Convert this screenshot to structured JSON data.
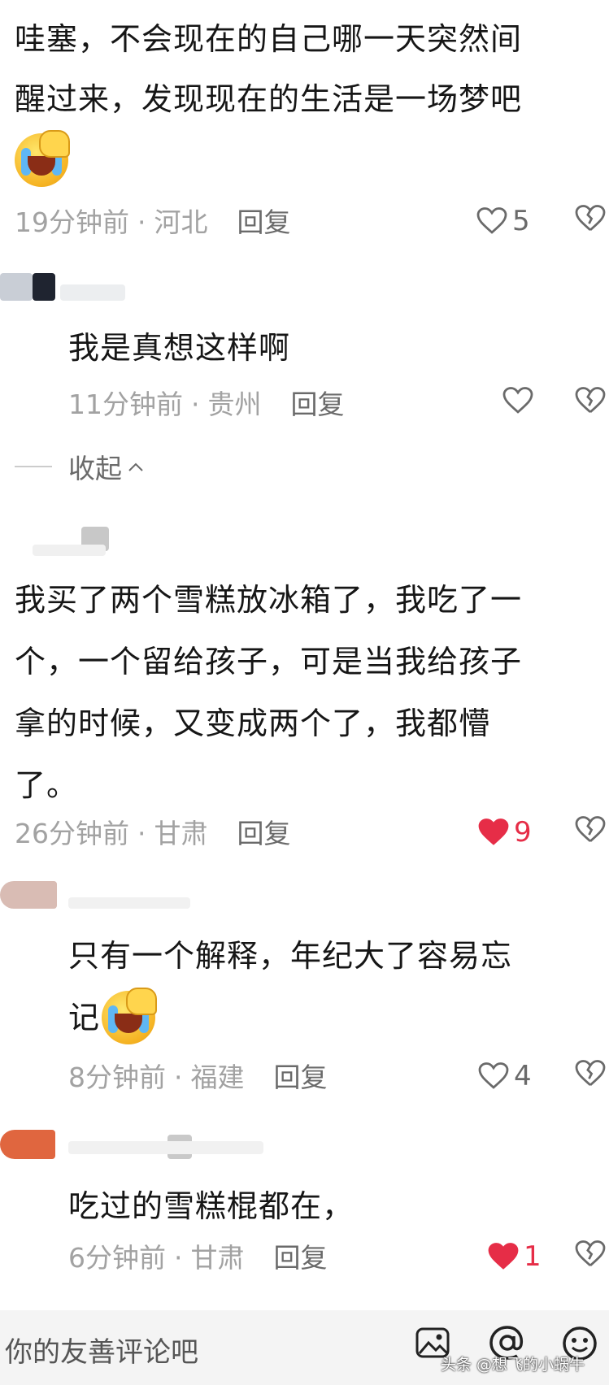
{
  "comments": [
    {
      "lines": [
        "哇塞，不会现在的自己哪一天突然间",
        "醒过来，发现现在的生活是一场梦吧"
      ],
      "emoji": "facepalm-laugh-cry",
      "time": "19分钟前",
      "location": "河北",
      "reply_label": "回复",
      "likes": "5",
      "liked": false
    },
    {
      "reply": true,
      "lines": [
        "我是真想这样啊"
      ],
      "time": "11分钟前",
      "location": "贵州",
      "reply_label": "回复",
      "likes": "",
      "liked": false
    },
    {
      "lines": [
        "我买了两个雪糕放冰箱了，我吃了一",
        "个，一个留给孩子，可是当我给孩子",
        "拿的时候，又变成两个了，我都懵",
        "了。"
      ],
      "time": "26分钟前",
      "location": "甘肃",
      "reply_label": "回复",
      "likes": "9",
      "liked": true
    },
    {
      "reply": true,
      "lines": [
        "只有一个解释，年纪大了容易忘",
        "记"
      ],
      "emoji": "facepalm-laugh-cry",
      "time": "8分钟前",
      "location": "福建",
      "reply_label": "回复",
      "likes": "4",
      "liked": false
    },
    {
      "reply": true,
      "lines": [
        "吃过的雪糕棍都在，"
      ],
      "time": "6分钟前",
      "location": "甘肃",
      "reply_label": "回复",
      "likes": "1",
      "liked": true
    }
  ],
  "collapse_label": "收起",
  "input": {
    "placeholder": "你的友善评论吧"
  },
  "watermark": "头条 @想飞的小蜗牛",
  "colors": {
    "liked": "#e62d47",
    "meta": "#a2a2a2",
    "reply": "#6a6a6a"
  },
  "icons": [
    "heart-icon",
    "dislike-heart-icon",
    "image-icon",
    "at-icon",
    "emoji-icon",
    "chevron-up-icon"
  ]
}
